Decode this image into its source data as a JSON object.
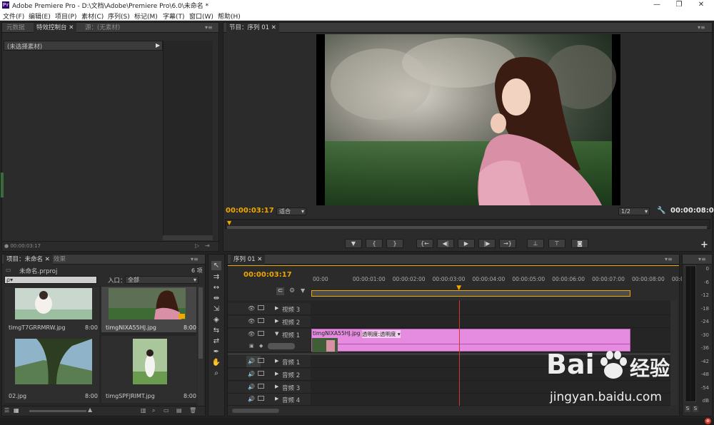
{
  "window": {
    "app_icon_text": "Pr",
    "title": "Adobe Premiere Pro - D:\\文档\\Adobe\\Premiere Pro\\6.0\\未命名 *",
    "minimize": "—",
    "restore": "❐",
    "close": "✕"
  },
  "menu": [
    "文件(F)",
    "编辑(E)",
    "项目(P)",
    "素材(C)",
    "序列(S)",
    "标记(M)",
    "字幕(T)",
    "窗口(W)",
    "帮助(H)"
  ],
  "effects_panel": {
    "tabs": [
      "元数据",
      "特效控制台",
      "源：(无素材)"
    ],
    "header_text": "(未选择素材)",
    "timecode": "00:00:03:17"
  },
  "program_monitor": {
    "tab": "节目：序列 01",
    "timecode_current": "00:00:03:17",
    "fit_select": "适合",
    "quality_select": "1/2",
    "timecode_duration": "00:00:08:00",
    "playhead_fraction": 0.46
  },
  "transport": {
    "marker": "▼",
    "mark_in": "{",
    "mark_out": "}",
    "go_in": "{←",
    "step_back": "◀|",
    "play": "▶",
    "step_forward": "|▶",
    "go_out": "→}",
    "lift": "⊥",
    "extract": "⊤",
    "export_frame": "◙",
    "add": "+"
  },
  "project_panel": {
    "tabs": [
      "项目：未命名",
      "效果"
    ],
    "item_count": "6 项",
    "project_file": "未命名.prproj",
    "search_placeholder": "ρ▾",
    "in_label": "入口：",
    "in_select": "全部",
    "clips": [
      {
        "name": "timgT7GRRMRW.jpg",
        "duration": "8:00"
      },
      {
        "name": "timgNIXA55HJ.jpg",
        "duration": "8:00"
      },
      {
        "name": "02.jpg",
        "duration": "8:00"
      },
      {
        "name": "timgSPFJRIMT.jpg",
        "duration": "8:00"
      }
    ]
  },
  "timeline": {
    "tab": "序列 01",
    "timecode": "00:00:03:17",
    "ruler": [
      "00:00",
      "00:00:01:00",
      "00:00:02:00",
      "00:00:03:00",
      "00:00:04:00",
      "00:00:05:00",
      "00:00:06:00",
      "00:00:07:00",
      "00:00:08:00",
      "00:0"
    ],
    "video_tracks": [
      "视频 3",
      "视频 2",
      "视频 1"
    ],
    "audio_tracks": [
      "音频 1",
      "音频 2",
      "音频 3",
      "音频 4"
    ],
    "clip_label": "timgNIXA55HJ.jpg",
    "clip_effect": "透明度:透明度 ▾",
    "playhead_seconds": 3.71,
    "sequence_seconds": 8
  },
  "audio_meter": {
    "labels": [
      "0",
      "-6",
      "-12",
      "-18",
      "-24",
      "-30",
      "-36",
      "-42",
      "-48",
      "-54",
      "dB"
    ],
    "solo_left": "S",
    "solo_right": "S"
  },
  "watermark": {
    "brand": "Bai",
    "brand2": "经验",
    "url": "jingyan.baidu.com"
  },
  "colors": {
    "accent_timecode": "#f0a800",
    "clip_pink": "#e58ce0",
    "playhead_red": "#d43a2a"
  }
}
